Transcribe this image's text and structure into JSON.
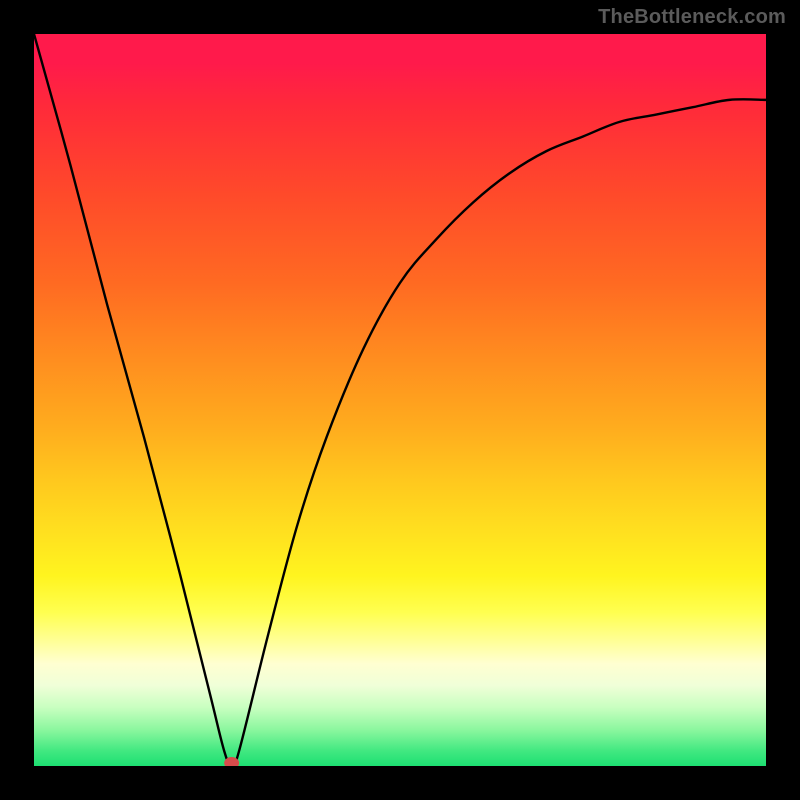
{
  "attribution": "TheBottleneck.com",
  "colors": {
    "background": "#000000",
    "gradient_top": "#ff1a4b",
    "gradient_bottom": "#1ddf72",
    "curve": "#000000",
    "marker": "#d64c4c"
  },
  "chart_data": {
    "type": "line",
    "title": "",
    "xlabel": "",
    "ylabel": "",
    "x_range": [
      0,
      100
    ],
    "y_range": [
      0,
      100
    ],
    "grid": false,
    "series": [
      {
        "name": "bottleneck-curve",
        "x": [
          0,
          5,
          10,
          15,
          20,
          24,
          26,
          27,
          28,
          32,
          36,
          40,
          45,
          50,
          55,
          60,
          65,
          70,
          75,
          80,
          85,
          90,
          95,
          100
        ],
        "y": [
          100,
          82,
          63,
          45,
          26,
          10,
          2,
          0,
          2,
          18,
          33,
          45,
          57,
          66,
          72,
          77,
          81,
          84,
          86,
          88,
          89,
          90,
          91,
          91
        ]
      }
    ],
    "annotations": [
      {
        "name": "minimum-marker",
        "x": 27,
        "y": 0
      }
    ],
    "notes": "V-shaped curve reaching y=0 near x≈27; left branch enters from top-left corner, right branch rises and asymptotically flattens toward ~91."
  }
}
